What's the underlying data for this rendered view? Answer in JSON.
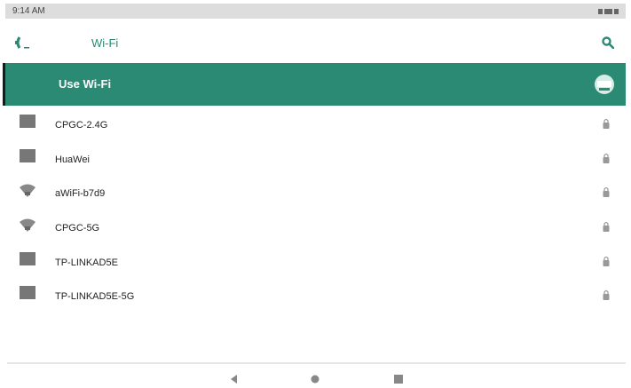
{
  "status_bar": {
    "time": "9:14 AM"
  },
  "toolbar": {
    "title": "Wi-Fi",
    "back_icon": "back-icon",
    "search_icon": "search-icon"
  },
  "master_switch": {
    "label": "Use Wi-Fi",
    "enabled": true
  },
  "networks": [
    {
      "name": "CPGC-2.4G",
      "icon": "signal-square-icon",
      "secured": true
    },
    {
      "name": "HuaWei",
      "icon": "signal-square-icon",
      "secured": true
    },
    {
      "name": "aWiFi-b7d9",
      "icon": "wifi-icon",
      "secured": true
    },
    {
      "name": "CPGC-5G",
      "icon": "wifi-icon",
      "secured": true
    },
    {
      "name": "TP-LINKAD5E",
      "icon": "signal-square-icon",
      "secured": true
    },
    {
      "name": "TP-LINKAD5E-5G",
      "icon": "signal-square-icon",
      "secured": true
    }
  ],
  "colors": {
    "accent": "#2b8a74",
    "status_bar": "#dddddd",
    "icon_gray": "#777777"
  }
}
